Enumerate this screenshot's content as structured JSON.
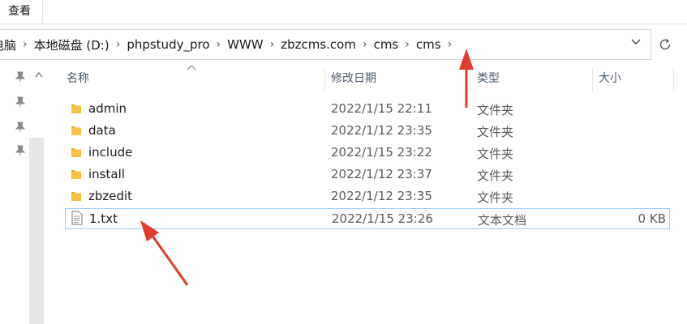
{
  "ribbon": {
    "view_tab": "查看"
  },
  "address_bar": {
    "breadcrumbs": [
      "电脑",
      "本地磁盘 (D:)",
      "phpstudy_pro",
      "WWW",
      "zbzcms.com",
      "cms",
      "cms"
    ],
    "separator": "›",
    "dropdown_icon": "chevron-down-icon",
    "refresh_icon": "refresh-icon"
  },
  "nav_pane": {
    "pin_icon": "pin-icon",
    "expand_icon": "caret-up-icon"
  },
  "columns": {
    "name": "名称",
    "date": "修改日期",
    "type": "类型",
    "size": "大小"
  },
  "files": [
    {
      "name": "admin",
      "date": "2022/1/15 22:11",
      "type": "文件夹",
      "size": "",
      "icon": "folder-icon"
    },
    {
      "name": "data",
      "date": "2022/1/12 23:35",
      "type": "文件夹",
      "size": "",
      "icon": "folder-icon"
    },
    {
      "name": "include",
      "date": "2022/1/15 23:22",
      "type": "文件夹",
      "size": "",
      "icon": "folder-icon"
    },
    {
      "name": "install",
      "date": "2022/1/12 23:37",
      "type": "文件夹",
      "size": "",
      "icon": "folder-icon"
    },
    {
      "name": "zbzedit",
      "date": "2022/1/12 23:35",
      "type": "文件夹",
      "size": "",
      "icon": "folder-icon"
    },
    {
      "name": "1.txt",
      "date": "2022/1/15 23:26",
      "type": "文本文档",
      "size": "0 KB",
      "icon": "text-file-icon"
    }
  ],
  "colors": {
    "accent": "#e23b2e",
    "selection_border": "#99d1ff",
    "folder": "#f6c244",
    "folder_tab": "#e7a92a"
  }
}
